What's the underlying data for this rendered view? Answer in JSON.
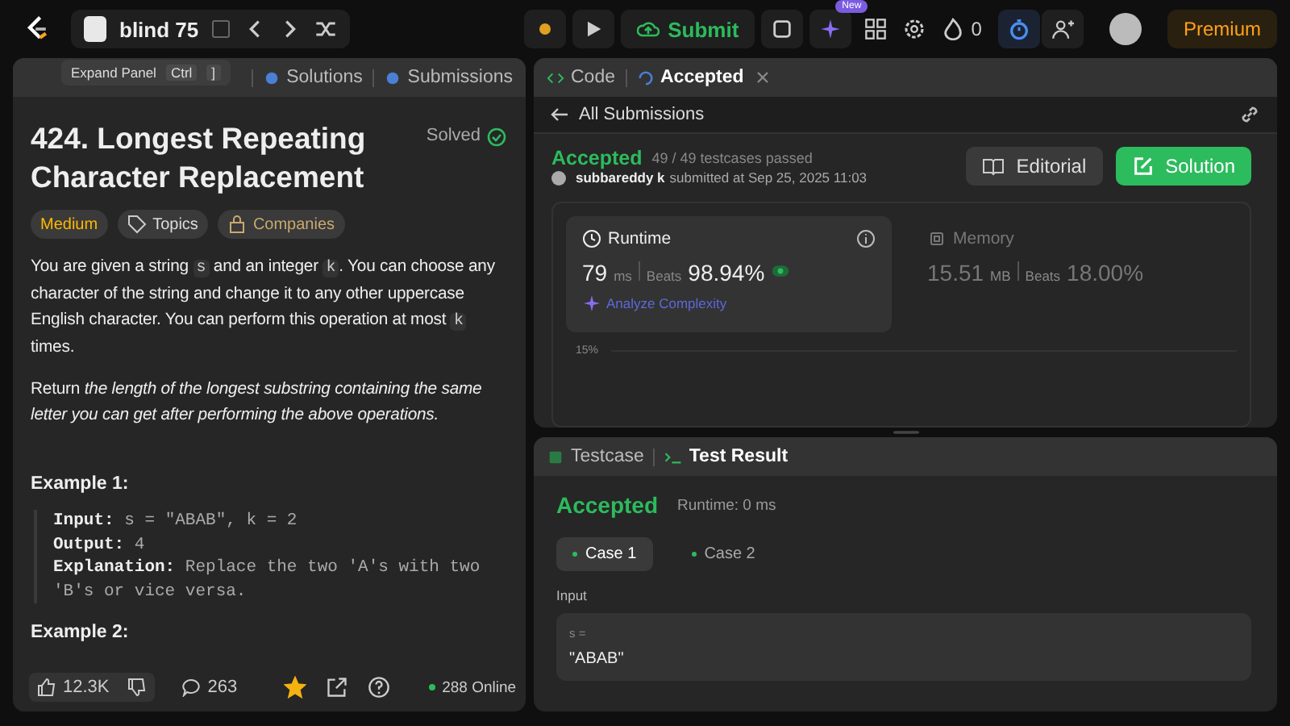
{
  "topbar": {
    "list_title": "blind 75",
    "submit": "Submit",
    "new_badge": "New",
    "streak": "0",
    "premium": "Premium"
  },
  "tooltip": {
    "label": "Expand Panel",
    "keys": [
      "Ctrl",
      "]"
    ]
  },
  "left_tabs": [
    {
      "label": "Solutions",
      "selected": false
    },
    {
      "label": "Submissions",
      "selected": false
    }
  ],
  "problem": {
    "title": "424. Longest Repeating Character Replacement",
    "status": "Solved",
    "difficulty": "Medium",
    "tags": [
      {
        "kind": "topics",
        "label": "Topics"
      },
      {
        "kind": "companies",
        "label": "Companies"
      }
    ],
    "paragraphs": [
      [
        {
          "kind": "text",
          "text": "You are given a string "
        },
        {
          "kind": "code",
          "text": "s"
        },
        {
          "kind": "text",
          "text": " and an integer "
        },
        {
          "kind": "code",
          "text": "k"
        },
        {
          "kind": "text",
          "text": ". You can choose any character of the string and change it to any other uppercase English character. You can perform this operation at most "
        },
        {
          "kind": "code",
          "text": "k"
        },
        {
          "kind": "text",
          "text": " times."
        }
      ],
      [
        {
          "kind": "rich",
          "text": "Return *the length of the longest substring containing the same letter you can get after performing the above operations.*"
        }
      ]
    ],
    "examples": [
      {
        "title": "Example 1:",
        "lines": [
          {
            "label": "Input:",
            "value": "s = \"ABAB\", k = 2"
          },
          {
            "label": "Output:",
            "value": "4"
          },
          {
            "label": "Explanation:",
            "value": "Replace the two 'A's with two 'B's or vice versa."
          }
        ]
      },
      {
        "title": "Example 2:"
      }
    ]
  },
  "footer": {
    "likes": "12.3K",
    "comments": "263",
    "favorited": true,
    "online": "288 Online"
  },
  "right_tabs": [
    {
      "label": "Code",
      "selected": false,
      "closable": false
    },
    {
      "label": "Accepted",
      "selected": true,
      "closable": true
    }
  ],
  "submission": {
    "back": "All Submissions",
    "status": "Accepted",
    "testcases": "49 / 49 testcases passed",
    "user": "subbareddy k",
    "submitted": "submitted at Sep 25, 2025 11:03",
    "editorial": "Editorial",
    "solution": "Solution",
    "metrics": [
      {
        "kind": "runtime",
        "label": "Runtime",
        "value": "79",
        "unit": "ms",
        "beats_label": "Beats",
        "beats": "98.94%",
        "selected": true
      },
      {
        "kind": "memory",
        "label": "Memory",
        "value": "15.51",
        "unit": "MB",
        "beats_label": "Beats",
        "beats": "18.00%",
        "selected": false
      }
    ],
    "analyze": "Analyze Complexity",
    "chart_tick": "15%"
  },
  "bottom_tabs": [
    {
      "label": "Testcase",
      "selected": false
    },
    {
      "label": "Test Result",
      "selected": true
    }
  ],
  "result": {
    "status": "Accepted",
    "runtime": "Runtime: 0 ms",
    "cases": [
      {
        "label": "Case 1",
        "selected": true
      },
      {
        "label": "Case 2",
        "selected": false
      }
    ],
    "input_label": "Input",
    "variable": "s =",
    "value": "\"ABAB\""
  }
}
